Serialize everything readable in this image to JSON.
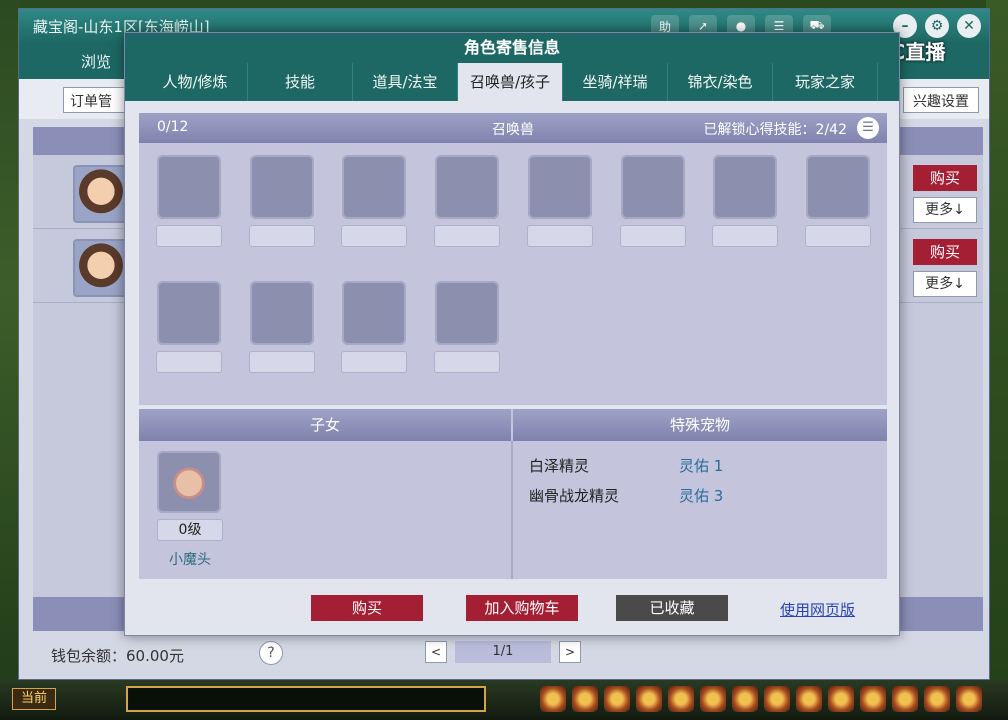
{
  "outer_window": {
    "title": "藏宝阁-山东1区[东海崂山]",
    "tab_browse": "浏览",
    "order_button": "订单管",
    "interest_button": "兴趣设置",
    "list_buy_label": "购买",
    "list_more_label": "更多↓",
    "wallet_text": "钱包余额：60.00元",
    "help_label": "?",
    "pager": {
      "prev": "<",
      "page": "1/1",
      "next": ">"
    }
  },
  "watermark": {
    "text": "CC直播"
  },
  "dialog": {
    "title": "角色寄售信息",
    "tabs": [
      {
        "label": "人物/修炼"
      },
      {
        "label": "技能"
      },
      {
        "label": "道具/法宝"
      },
      {
        "label": "召唤兽/孩子",
        "active": true
      },
      {
        "label": "坐骑/祥瑞"
      },
      {
        "label": "锦衣/染色"
      },
      {
        "label": "玩家之家"
      }
    ],
    "summon_section": {
      "count": "0/12",
      "title": "召唤兽",
      "skills_unlocked": "已解锁心得技能：2/42",
      "slot_count": 12
    },
    "children_section": {
      "title": "子女",
      "child": {
        "level": "0级",
        "name": "小魔头"
      }
    },
    "special_pets_section": {
      "title": "特殊宠物",
      "pets": [
        {
          "name": "白泽精灵",
          "value": "灵佑 1"
        },
        {
          "name": "幽骨战龙精灵",
          "value": "灵佑 3"
        }
      ]
    },
    "actions": {
      "buy": "购买",
      "add_to_cart": "加入购物车",
      "favorited": "已收藏",
      "web_version": "使用网页版"
    }
  },
  "game_hud": {
    "chat_mode": "当前"
  }
}
